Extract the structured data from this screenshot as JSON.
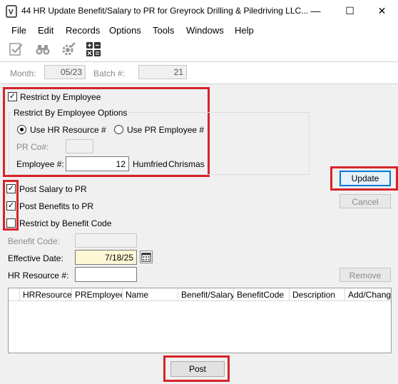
{
  "window": {
    "title": "44 HR Update Benefit/Salary to PR for Greyrock Drilling & Piledriving LLC...",
    "minimize": "—",
    "maximize": "☐",
    "close": "✕"
  },
  "menu": [
    "File",
    "Edit",
    "Records",
    "Options",
    "Tools",
    "Windows",
    "Help"
  ],
  "toolbar": [
    "validate-icon",
    "binoculars-icon",
    "settings-gear-icon",
    "calculator-icon"
  ],
  "header": {
    "month_label": "Month:",
    "month_value": "05/23",
    "batch_label": "Batch #:",
    "batch_value": "21"
  },
  "restrict": {
    "by_employee_label": "Restrict by Employee",
    "by_employee_checked": true,
    "options_title": "Restrict By Employee Options",
    "radio_hr_label": "Use HR Resource #",
    "radio_pr_label": "Use PR Employee #",
    "selected": "hr",
    "pr_co_label": "PR Co#:",
    "pr_co_value": "",
    "employee_label": "Employee #:",
    "employee_value": "12",
    "employee_first": "Humfried",
    "employee_last": "Chrismas"
  },
  "post_options": {
    "post_salary_label": "Post Salary to PR",
    "post_salary_checked": true,
    "post_benefits_label": "Post Benefits to PR",
    "post_benefits_checked": true,
    "restrict_benefit_label": "Restrict by Benefit Code",
    "restrict_benefit_checked": false
  },
  "fields": {
    "benefit_code_label": "Benefit Code:",
    "benefit_code_value": "",
    "effective_date_label": "Effective Date:",
    "effective_date_value": "7/18/25",
    "hr_resource_label": "HR Resource #:",
    "hr_resource_value": ""
  },
  "buttons": {
    "update": "Update",
    "cancel": "Cancel",
    "remove": "Remove",
    "post": "Post"
  },
  "grid": {
    "columns": [
      "HRResource",
      "PREmployee",
      "Name",
      "Benefit/Salary",
      "BenefitCode",
      "Description",
      "Add/Change"
    ]
  },
  "colors": {
    "highlight": "#d6232a",
    "date_field_bg": "#fff8d6",
    "focus_blue": "#0078d7"
  }
}
